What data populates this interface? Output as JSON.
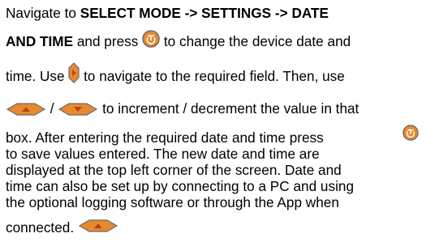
{
  "colors": {
    "icon_fill": "#e8892f",
    "icon_stroke": "#6c6c6c",
    "icon_glyph": "#ffffff",
    "arrow_glyph": "#b84415"
  },
  "icons": {
    "ok": "round-ok-button-icon",
    "right": "right-arrow-button-icon",
    "up": "up-arrow-button-icon",
    "down": "down-arrow-button-icon"
  },
  "text": {
    "l1_a": "Navigate to ",
    "l1_b": "SELECT MODE -> SETTINGS -> DATE",
    "l2_a": "AND TIME",
    "l2_b": " and press ",
    "l2_c": " to change the device date and",
    "l3_a": "time. Use ",
    "l3_b": " to navigate to the required field. Then, use",
    "l4_slash": " / ",
    "l4_b": " to increment / decrement the value in that",
    "l5": "box. After entering the required date and time press",
    "l6": "to save values entered. The new date and time are",
    "l7": "displayed at the top left corner of the screen. Date and",
    "l8": "time can also be set up by connecting to a PC and using",
    "l9": "the optional logging software or through the App when",
    "l10": "connected. "
  }
}
